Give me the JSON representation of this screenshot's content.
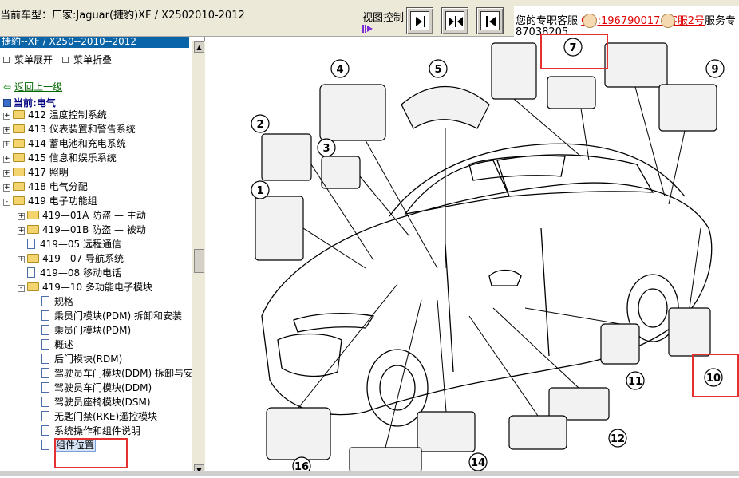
{
  "header": {
    "title_prefix": "当前车型：",
    "title": "厂家:Jaguar(捷豹)XF / X2502010-2012",
    "view_control_label": "视图控制",
    "service_text": "您的专职客服",
    "qq_link": "QQ:1967900174",
    "service2_link": "客服2号",
    "service_suffix": "服务专",
    "phone": "87038205"
  },
  "sidebar": {
    "header": "捷豹--XF / X250--2010--2012",
    "expand_all": "菜单展开",
    "collapse_all": "菜单折叠",
    "back_link": "返回上一级",
    "current_label": "当前:电气",
    "tree": [
      {
        "label": "412 温度控制系统",
        "type": "folder",
        "expander": "+"
      },
      {
        "label": "413 仪表装置和警告系统",
        "type": "folder",
        "expander": "+"
      },
      {
        "label": "414 蓄电池和充电系统",
        "type": "folder",
        "expander": "+"
      },
      {
        "label": "415 信息和娱乐系统",
        "type": "folder",
        "expander": "+"
      },
      {
        "label": "417 照明",
        "type": "folder",
        "expander": "+"
      },
      {
        "label": "418 电气分配",
        "type": "folder",
        "expander": "+"
      },
      {
        "label": "419 电子功能组",
        "type": "folder",
        "expander": "-"
      },
      {
        "label": "419—01A 防盗 — 主动",
        "type": "folder",
        "expander": "+"
      },
      {
        "label": "419—01B 防盗 — 被动",
        "type": "folder",
        "expander": "+"
      },
      {
        "label": "419—05 远程通信",
        "type": "doc",
        "expander": ""
      },
      {
        "label": "419—07 导航系统",
        "type": "folder",
        "expander": "+"
      },
      {
        "label": "419—08 移动电话",
        "type": "doc",
        "expander": ""
      },
      {
        "label": "419—10 多功能电子模块",
        "type": "folder",
        "expander": "-"
      },
      {
        "label": "规格",
        "type": "doc",
        "expander": ""
      },
      {
        "label": "乘员门模块(PDM) 拆卸和安装",
        "type": "doc",
        "expander": ""
      },
      {
        "label": "乘员门模块(PDM)",
        "type": "doc",
        "expander": ""
      },
      {
        "label": "概述",
        "type": "doc",
        "expander": ""
      },
      {
        "label": "后门模块(RDM)",
        "type": "doc",
        "expander": ""
      },
      {
        "label": "驾驶员车门模块(DDM) 拆卸与安装",
        "type": "doc",
        "expander": ""
      },
      {
        "label": "驾驶员车门模块(DDM)",
        "type": "doc",
        "expander": ""
      },
      {
        "label": "驾驶员座椅模块(DSM)",
        "type": "doc",
        "expander": ""
      },
      {
        "label": "无匙门禁(RKE)遥控模块",
        "type": "doc",
        "expander": ""
      },
      {
        "label": "系统操作和组件说明",
        "type": "doc",
        "expander": ""
      },
      {
        "label": "组件位置",
        "type": "doc",
        "expander": "",
        "selected": true
      }
    ]
  },
  "diagram": {
    "callouts": [
      "1",
      "2",
      "3",
      "4",
      "5",
      "7",
      "9",
      "10",
      "11",
      "12",
      "14",
      "16"
    ]
  },
  "colors": {
    "highlight": "#e53030",
    "sidebar_header": "#0a64a8",
    "link_red": "#e00000"
  }
}
